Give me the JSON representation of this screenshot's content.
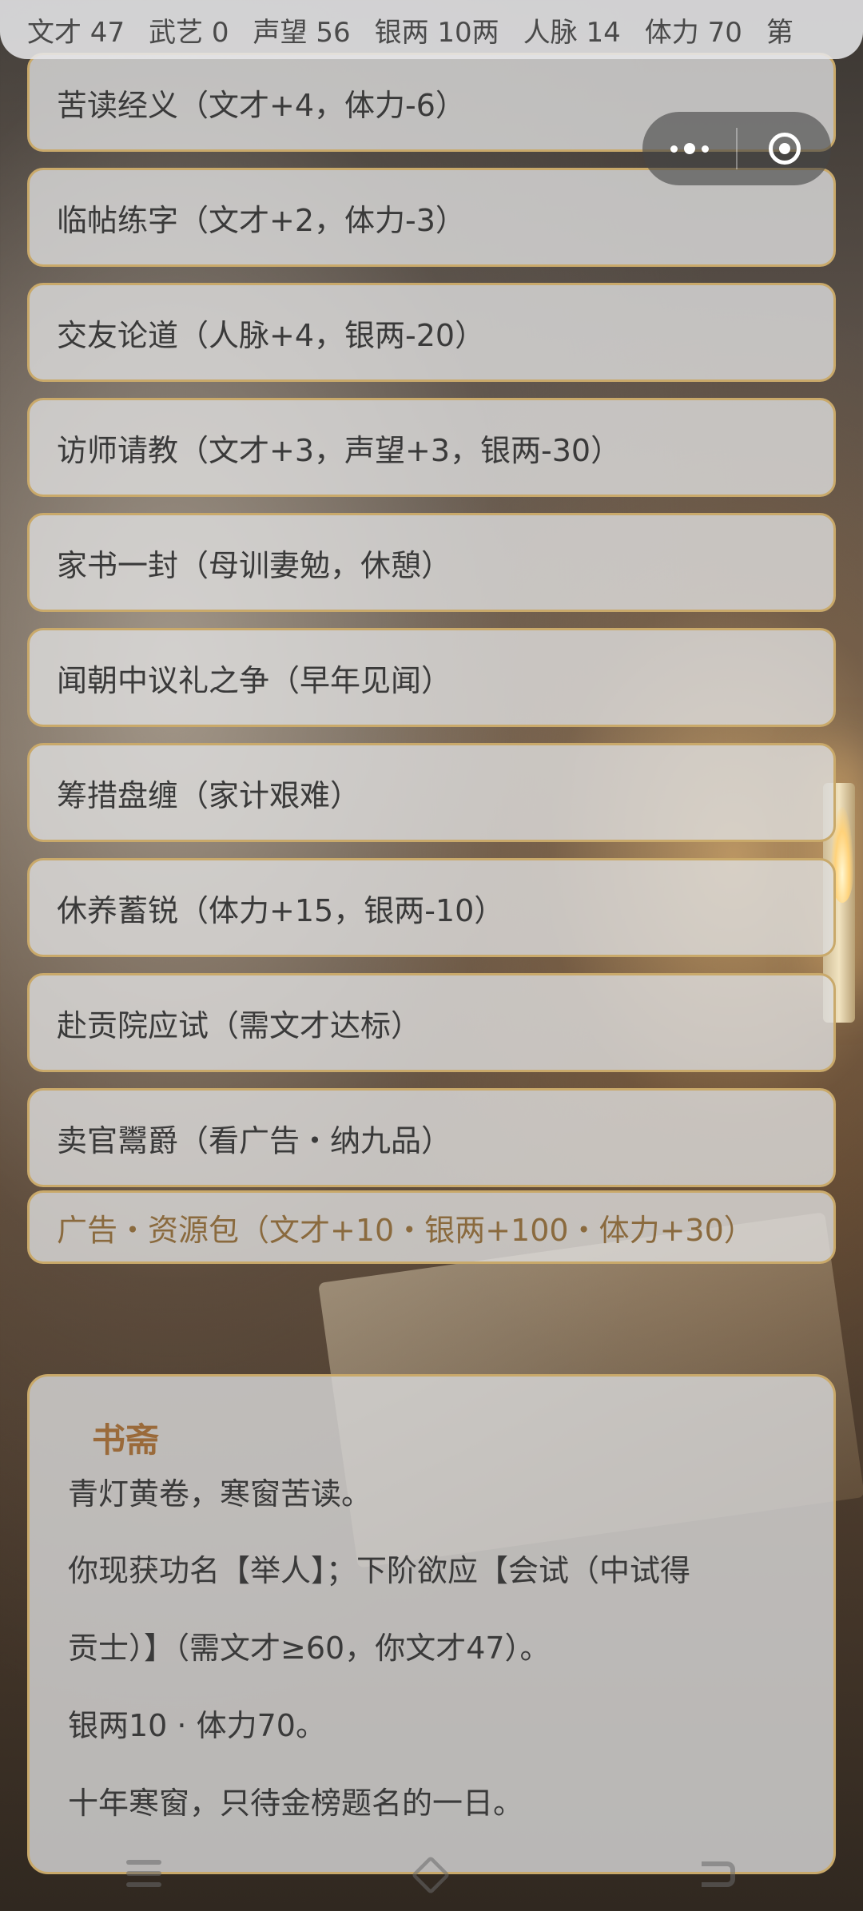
{
  "stats": [
    {
      "label": "文才 47"
    },
    {
      "label": "武艺 0"
    },
    {
      "label": "声望 56"
    },
    {
      "label": "银两 10两"
    },
    {
      "label": "人脉 14"
    },
    {
      "label": "体力 70"
    },
    {
      "label": "第"
    }
  ],
  "actions": [
    {
      "label": "苦读经义（文才+4，体力-6）"
    },
    {
      "label": "临帖练字（文才+2，体力-3）"
    },
    {
      "label": "交友论道（人脉+4，银两-20）"
    },
    {
      "label": "访师请教（文才+3，声望+3，银两-30）"
    },
    {
      "label": "家书一封（母训妻勉，休憩）"
    },
    {
      "label": "闻朝中议礼之争（早年见闻）"
    },
    {
      "label": "筹措盘缠（家计艰难）"
    },
    {
      "label": "休养蓄锐（体力+15，银两-10）"
    },
    {
      "label": "赴贡院应试（需文才达标）"
    },
    {
      "label": "卖官鬻爵（看广告・纳九品）"
    }
  ],
  "ad_action": {
    "label": "广告・资源包（文才+10・银两+100・体力+30）"
  },
  "panel": {
    "title": "书斋",
    "line1": "青灯黄卷，寒窗苦读。",
    "line2": "你现获功名【举人】；下阶欲应【会试（中试得",
    "line3": "贡士）】（需文才≥60，你文才47）。",
    "line4": "银两10 · 体力70。",
    "line5": "十年寒窗，只待金榜题名的一日。"
  },
  "icons": {
    "capsule_more": "more-dots-icon",
    "capsule_close": "close-target-icon",
    "nav_menu": "menu-icon",
    "nav_home": "home-icon",
    "nav_back": "back-icon"
  }
}
